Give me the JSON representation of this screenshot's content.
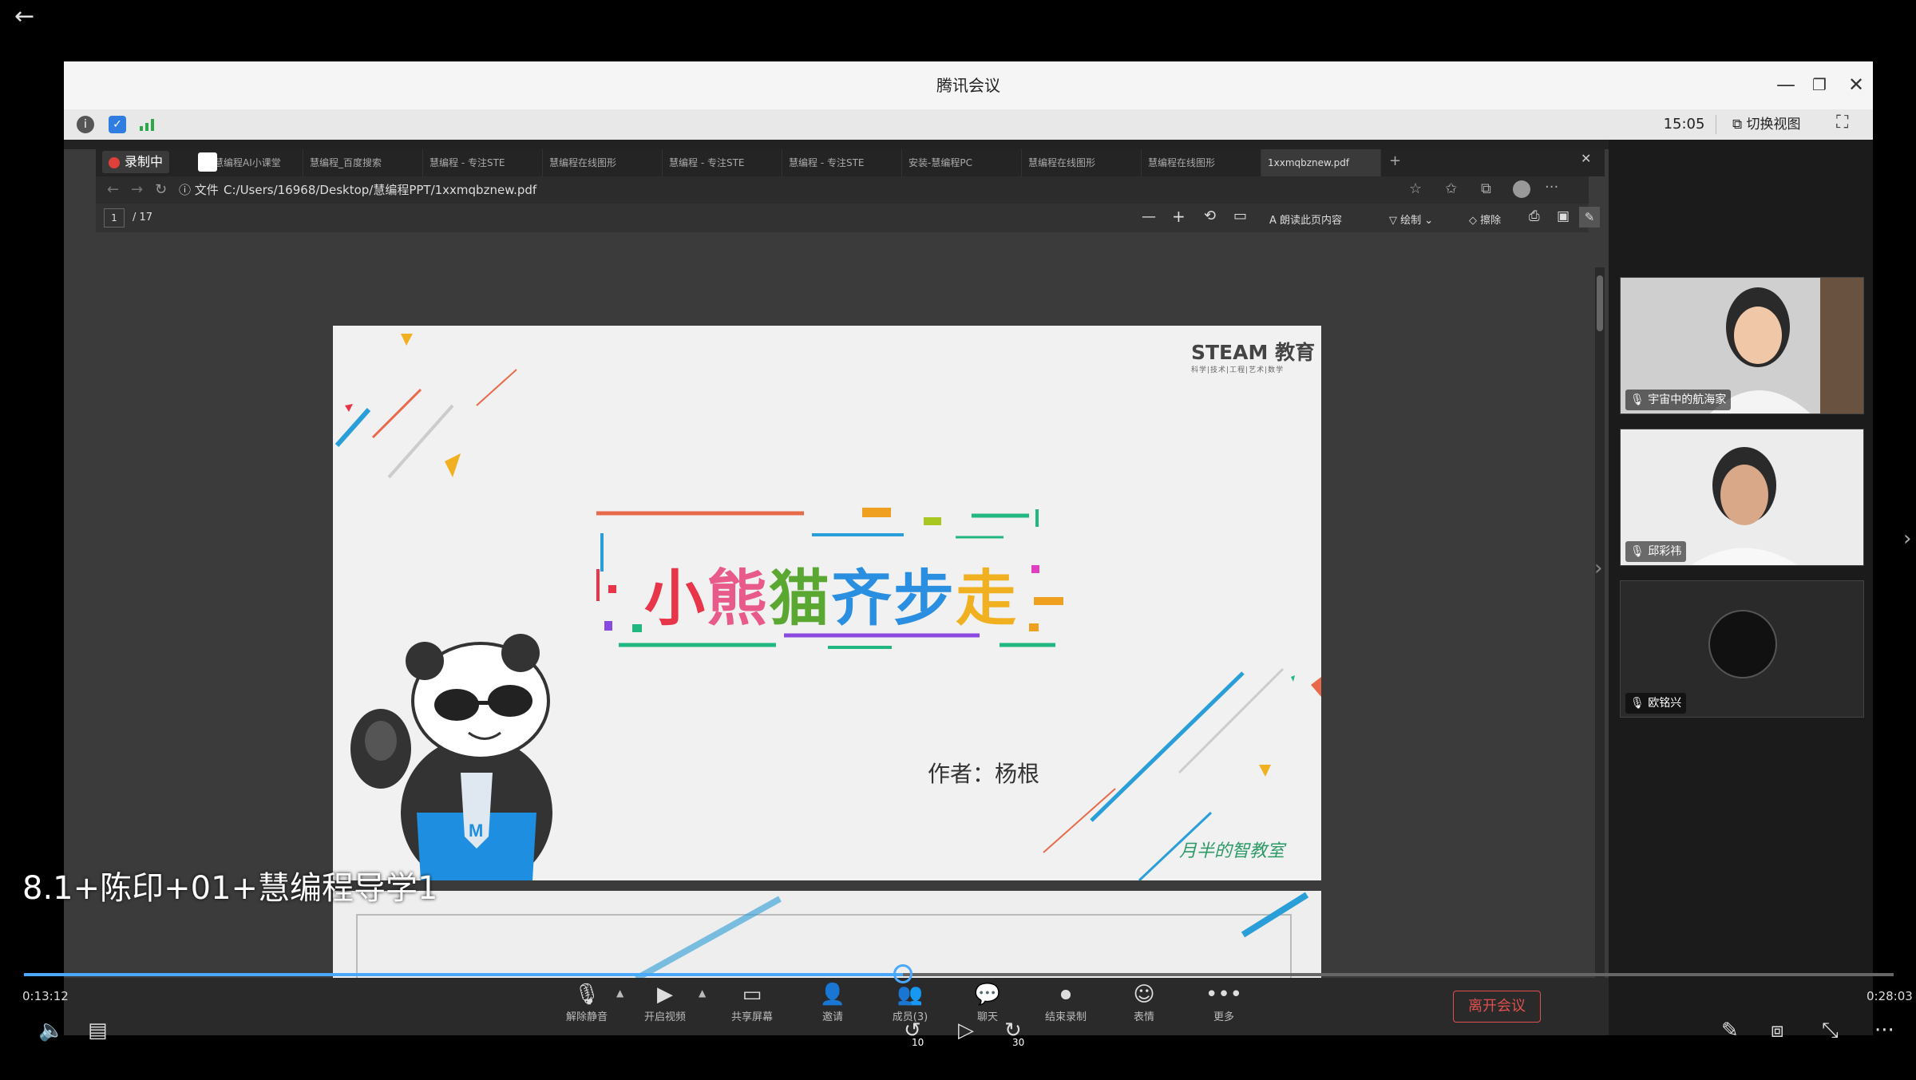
{
  "window": {
    "title": "腾讯会议",
    "time": "15:05",
    "switch_view": "切换视图"
  },
  "recording": {
    "label": "录制中"
  },
  "browser": {
    "tabs": [
      "慧编程AI小课堂",
      "慧编程_百度搜索",
      "慧编程 - 专注STE",
      "慧编程在线图形",
      "慧编程 - 专注STE",
      "慧编程 - 专注STE",
      "安装-慧编程PC",
      "慧编程在线图形",
      "慧编程在线图形",
      "1xxmqbznew.pdf"
    ],
    "address_prefix": "文件",
    "address": "C:/Users/16968/Desktop/慧编程PPT/1xxmqbznew.pdf",
    "page_current": "1",
    "page_total": "/ 17",
    "read_aloud": "朗读此页内容",
    "draw": "绘制",
    "erase": "擦除"
  },
  "slide": {
    "brand": "STEAM 教育",
    "brand_sub": "科学|技术|工程|艺术|数学",
    "title_chars": [
      "小",
      "熊",
      "猫",
      "齐",
      "步",
      "走"
    ],
    "author": "作者：杨根",
    "signature": "月半的智教室"
  },
  "participants": [
    {
      "name": "宇宙中的航海家"
    },
    {
      "name": "邱彩祎"
    },
    {
      "name": "欧铭兴"
    }
  ],
  "toolbar": {
    "unmute": "解除静音",
    "video": "开启视频",
    "share": "共享屏幕",
    "invite": "邀请",
    "members": "成员(3)",
    "chat": "聊天",
    "stop_record": "结束录制",
    "emoji": "表情",
    "more": "更多",
    "leave": "离开会议"
  },
  "player": {
    "video_title": "8.1+陈印+01+慧编程导学1",
    "current_time": "0:13:12",
    "duration": "0:28:03",
    "progress": 0.47,
    "rewind_label": "10",
    "forward_label": "30"
  },
  "colors": {
    "accent": "#4aa8ff",
    "title_colors": [
      "#e8354a",
      "#e85a8a",
      "#5aa832",
      "#2a8fe0",
      "#2a8fe0",
      "#f0b020"
    ]
  }
}
